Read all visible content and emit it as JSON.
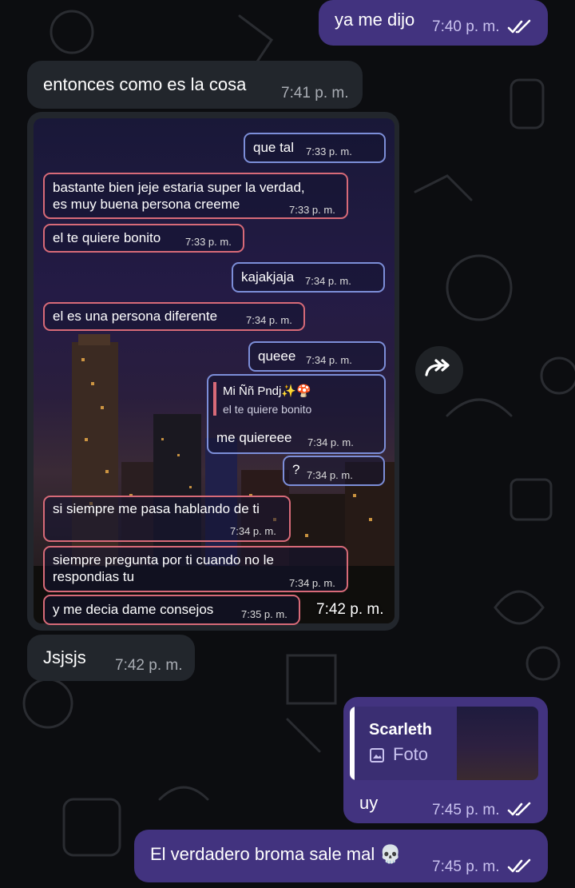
{
  "messages": [
    {
      "id": "m1",
      "direction": "out",
      "text": "ya me dijo",
      "time": "7:40 p. m.",
      "status": "read"
    },
    {
      "id": "m2",
      "direction": "in",
      "text": "entonces como es la cosa",
      "time": "7:41 p. m."
    },
    {
      "id": "m3",
      "direction": "in",
      "type": "photo",
      "time": "7:42 p. m."
    },
    {
      "id": "m4",
      "direction": "in",
      "text": "Jsjsjs",
      "time": "7:42 p. m."
    },
    {
      "id": "m5",
      "direction": "out",
      "text": "uy",
      "time": "7:45 p. m.",
      "status": "read",
      "reply": {
        "name": "Scarleth",
        "type": "Foto"
      }
    },
    {
      "id": "m6",
      "direction": "out",
      "text": "El verdadero broma sale mal 💀",
      "time": "7:45 p. m.",
      "status": "read"
    }
  ],
  "photo_screenshot": {
    "messages": [
      {
        "side": "out",
        "text": "que tal",
        "time": "7:33 p. m."
      },
      {
        "side": "in",
        "text": "bastante bien jeje estaria super la verdad,",
        "text2": "es muy buena persona creeme",
        "time": "7:33 p. m."
      },
      {
        "side": "in",
        "text": "el te quiere bonito",
        "time": "7:33 p. m."
      },
      {
        "side": "out",
        "text": "kajakjaja",
        "time": "7:34 p. m."
      },
      {
        "side": "in",
        "text": "el es una persona diferente",
        "time": "7:34 p. m."
      },
      {
        "side": "out",
        "text": "queee",
        "time": "7:34 p. m."
      },
      {
        "side": "out",
        "text": "me quiereee",
        "time": "7:34 p. m.",
        "reply_name": "Mi Ññ Pndj✨🍄",
        "reply_text": "el te quiere bonito"
      },
      {
        "side": "out",
        "text": "?",
        "time": "7:34 p. m."
      },
      {
        "side": "in",
        "text": "si siempre me pasa hablando de ti",
        "time": "7:34 p. m."
      },
      {
        "side": "in",
        "text": "siempre pregunta por ti cuando no le",
        "text2": "respondias tu",
        "time": "7:34 p. m."
      },
      {
        "side": "in",
        "text": "y me decia dame consejos",
        "time": "7:35 p. m."
      }
    ]
  },
  "colors": {
    "outgoing": "#42337f",
    "incoming": "#22262c",
    "background": "#0c0d10"
  },
  "icons": {
    "forward": "forward-icon",
    "read": "double-check-icon",
    "photo": "image-icon"
  }
}
